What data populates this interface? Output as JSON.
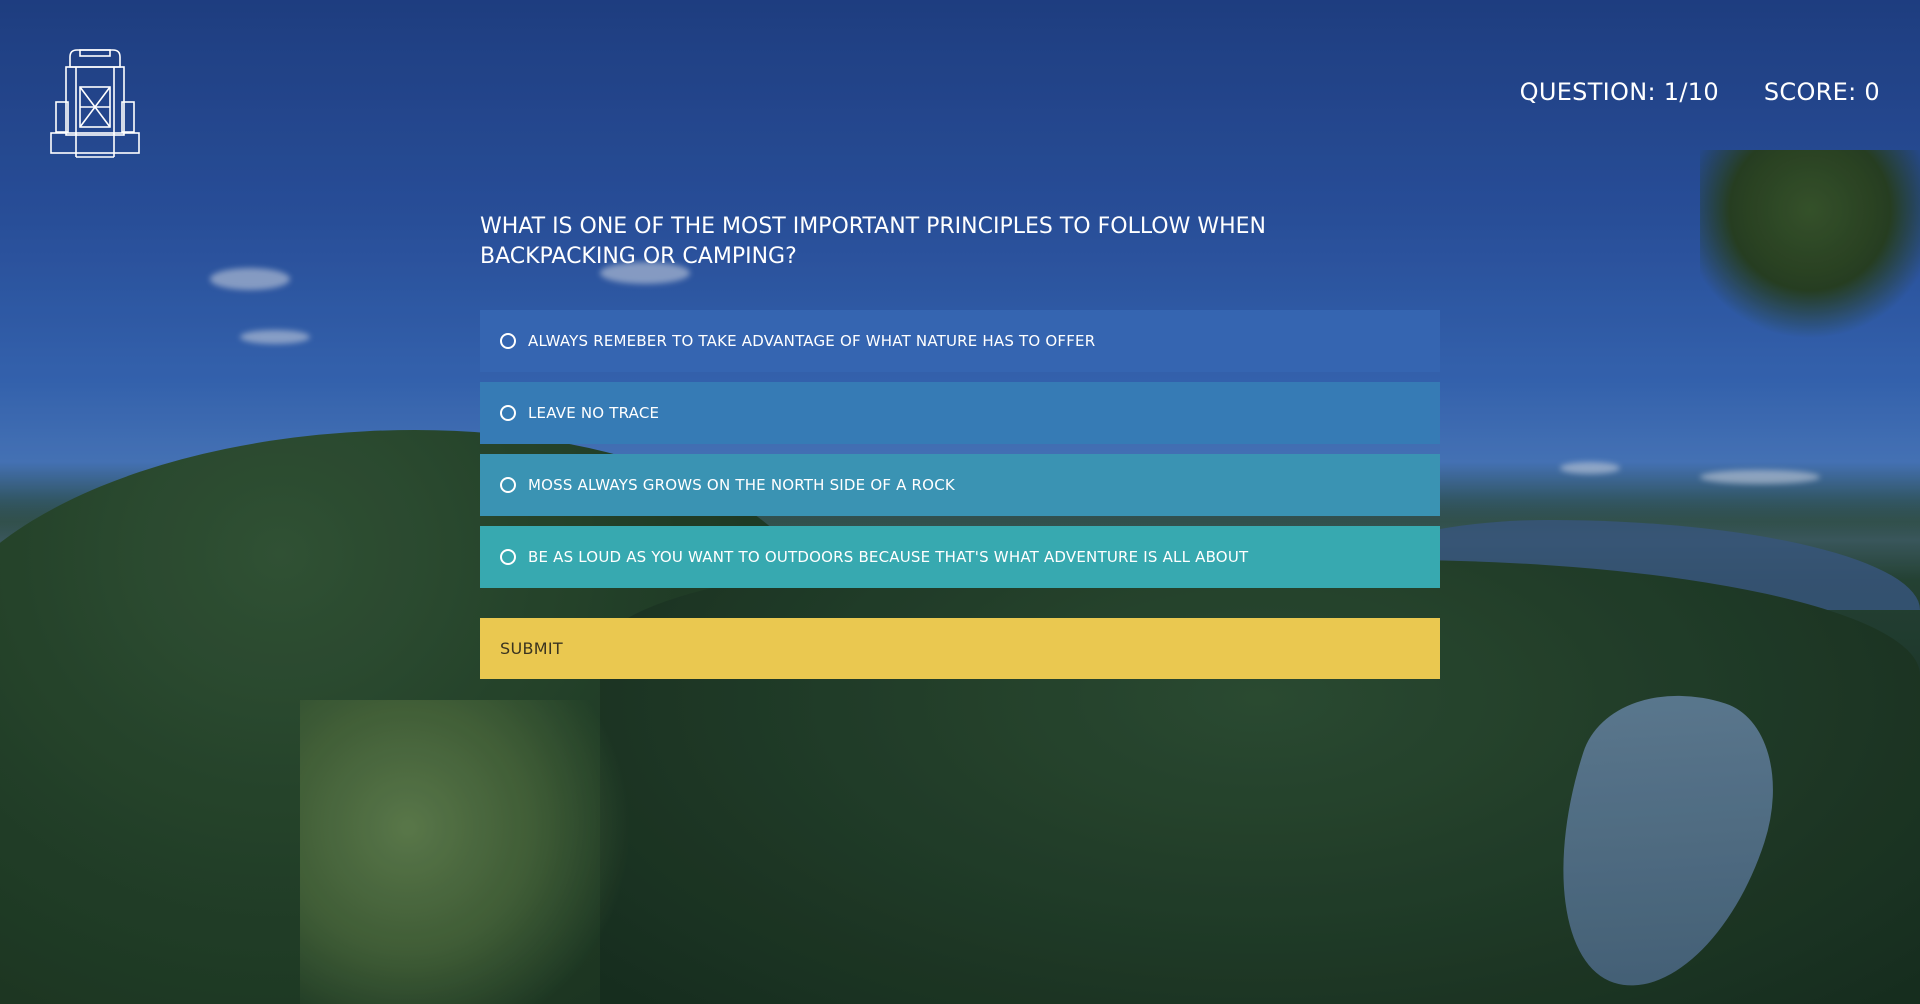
{
  "header": {
    "logo_icon": "backpack-icon",
    "question_counter": "QUESTION: 1/10",
    "score": "SCORE: 0"
  },
  "quiz": {
    "question": "WHAT IS ONE OF THE MOST IMPORTANT PRINCIPLES TO FOLLOW WHEN BACKPACKING OR CAMPING?",
    "options": [
      {
        "label": "ALWAYS REMEBER TO TAKE ADVANTAGE OF WHAT NATURE HAS TO OFFER",
        "color": "#3565b1",
        "selected": false
      },
      {
        "label": "LEAVE NO TRACE",
        "color": "#367bb5",
        "selected": false
      },
      {
        "label": "MOSS ALWAYS GROWS ON THE NORTH SIDE OF A ROCK",
        "color": "#3a93b3",
        "selected": false
      },
      {
        "label": "BE AS LOUD AS YOU WANT TO OUTDOORS BECAUSE THAT'S WHAT ADVENTURE IS ALL ABOUT",
        "color": "#37a9b0",
        "selected": false
      }
    ],
    "submit_label": "SUBMIT",
    "submit_color": "#eac850"
  }
}
